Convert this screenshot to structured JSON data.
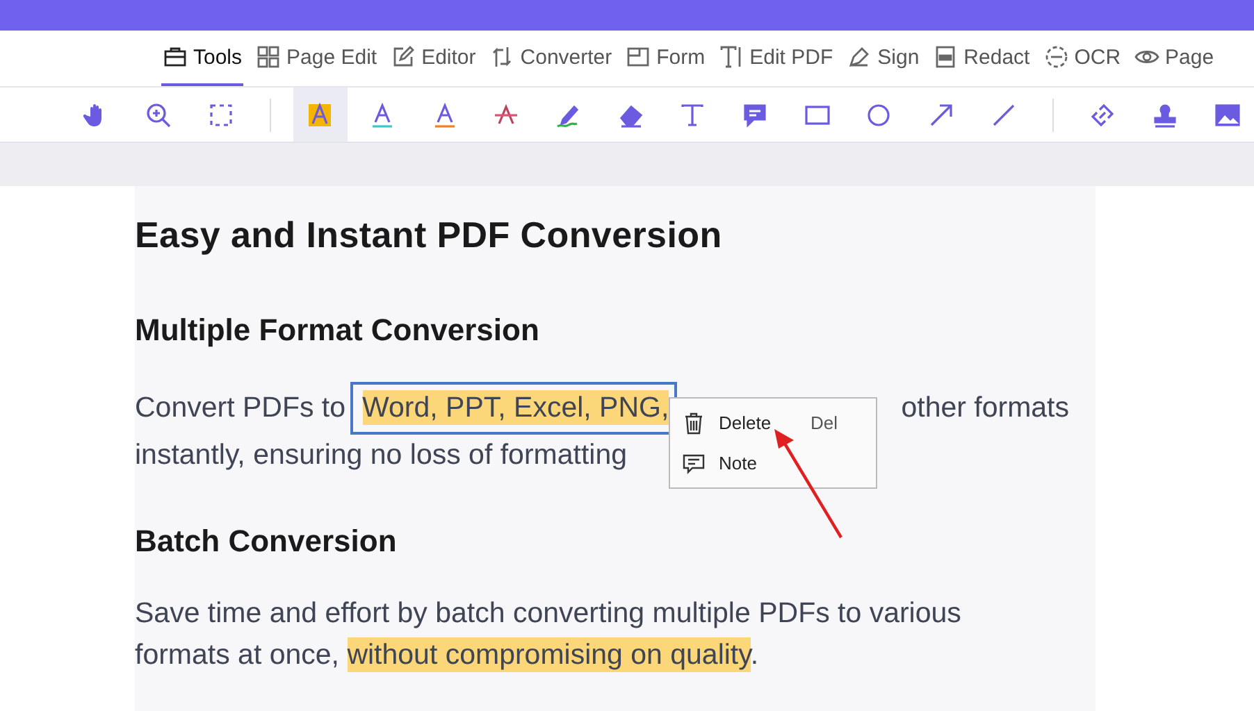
{
  "tabs": [
    {
      "label": "Tools",
      "kind": "toolbox",
      "selected": true
    },
    {
      "label": "Page Edit",
      "kind": "grid",
      "selected": false
    },
    {
      "label": "Editor",
      "kind": "edit",
      "selected": false
    },
    {
      "label": "Converter",
      "kind": "convert",
      "selected": false
    },
    {
      "label": "Form",
      "kind": "form",
      "selected": false
    },
    {
      "label": "Edit PDF",
      "kind": "textcursor",
      "selected": false
    },
    {
      "label": "Sign",
      "kind": "pen",
      "selected": false
    },
    {
      "label": "Redact",
      "kind": "redact",
      "selected": false
    },
    {
      "label": "OCR",
      "kind": "ocr",
      "selected": false
    },
    {
      "label": "Page",
      "kind": "eye",
      "selected": false
    }
  ],
  "toolbar": [
    {
      "kind": "hand",
      "selected": false
    },
    {
      "kind": "zoom",
      "selected": false
    },
    {
      "kind": "select",
      "selected": false
    },
    {
      "kind": "divider"
    },
    {
      "kind": "highlight",
      "selected": true
    },
    {
      "kind": "underline",
      "selected": false
    },
    {
      "kind": "squiggly",
      "selected": false
    },
    {
      "kind": "strike",
      "selected": false
    },
    {
      "kind": "pencil",
      "selected": false
    },
    {
      "kind": "eraser",
      "selected": false
    },
    {
      "kind": "text",
      "selected": false
    },
    {
      "kind": "comment",
      "selected": false
    },
    {
      "kind": "rectangle",
      "selected": false
    },
    {
      "kind": "circle",
      "selected": false
    },
    {
      "kind": "arrow",
      "selected": false
    },
    {
      "kind": "line",
      "selected": false
    },
    {
      "kind": "divider"
    },
    {
      "kind": "link",
      "selected": false
    },
    {
      "kind": "stamp",
      "selected": false
    },
    {
      "kind": "image",
      "selected": false
    }
  ],
  "document": {
    "title": "Easy and Instant PDF Conversion",
    "section_1": {
      "heading": "Multiple Format Conversion",
      "line_1_start": "Convert PDFs to",
      "highlighted": "Word, PPT, Excel, PNG,",
      "line_1_end": "other formats",
      "line_2": "instantly, ensuring no loss of formatting"
    },
    "section_2": {
      "heading": "Batch Conversion",
      "line_1": "Save time and effort by batch converting multiple PDFs to various",
      "line_2_start": "formats at once,",
      "highlighted": "without compromising on quality",
      "line_2_end": "."
    }
  },
  "context_menu": [
    {
      "label": "Delete",
      "kind": "trash",
      "shortcut": "Del"
    },
    {
      "label": "Note",
      "kind": "note"
    }
  ]
}
